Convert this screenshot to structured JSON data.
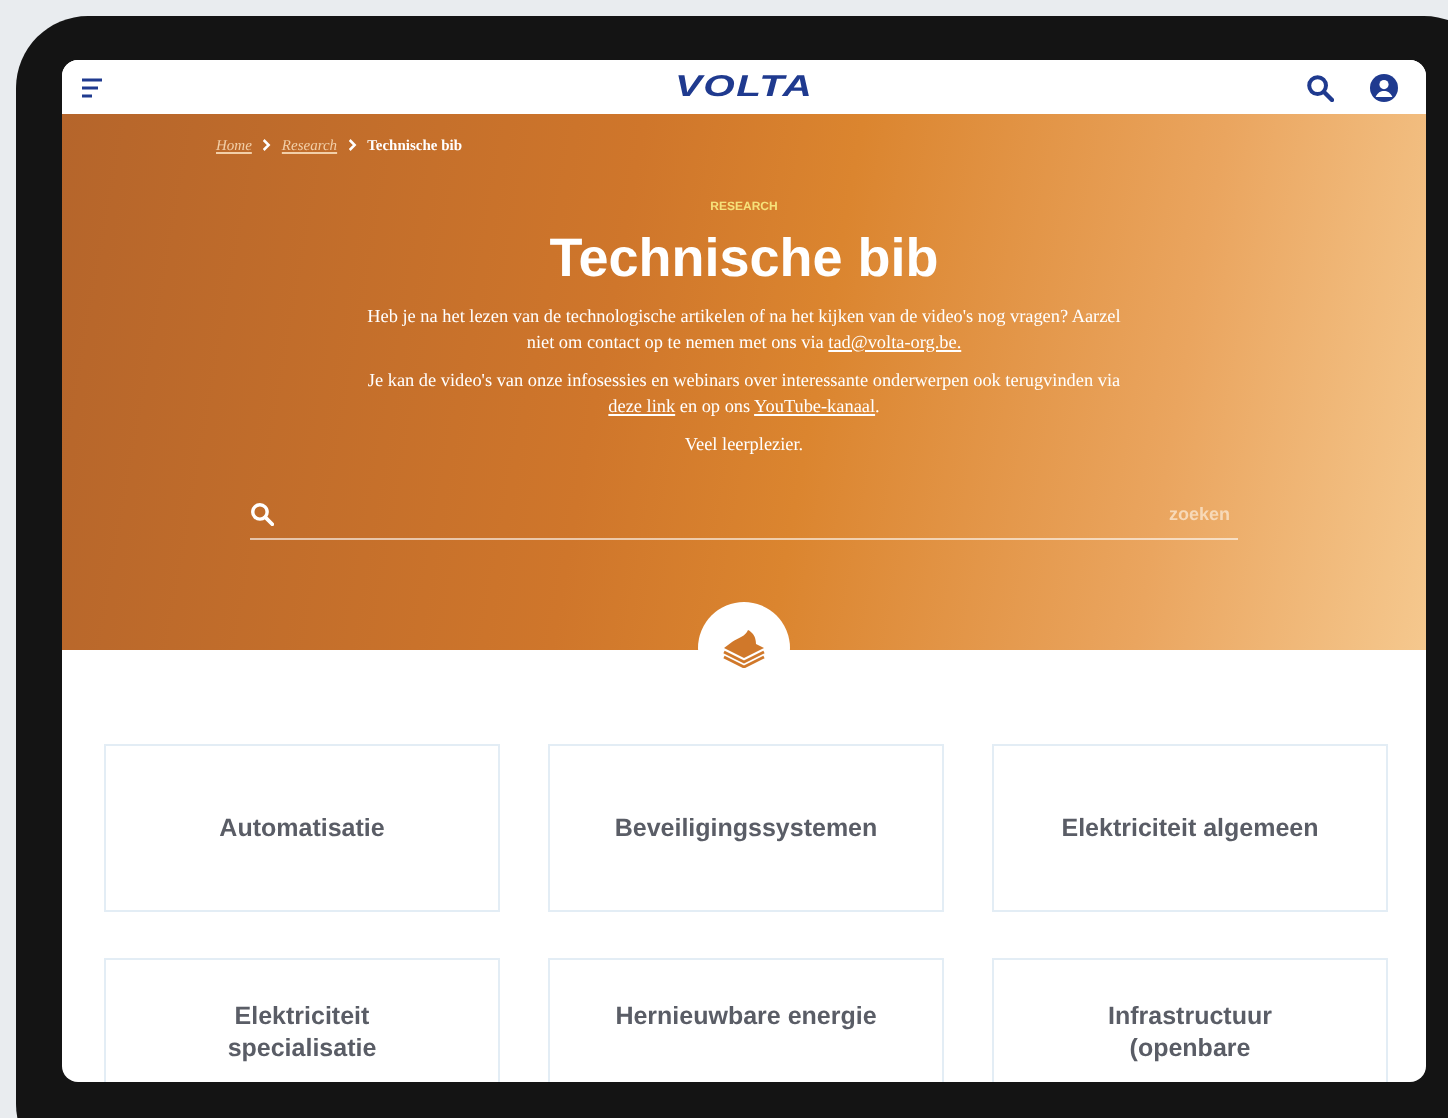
{
  "header": {
    "logo": "VOLTA"
  },
  "breadcrumbs": [
    {
      "label": "Home",
      "kind": "link"
    },
    {
      "label": "Research",
      "kind": "link"
    },
    {
      "label": "Technische bib",
      "kind": "current"
    }
  ],
  "hero": {
    "eyebrow": "RESEARCH",
    "title": "Technische bib",
    "paragraphs": [
      [
        {
          "kind": "text",
          "text": "Heb je na het lezen van de technologische artikelen of na het kijken van de video's nog vragen? Aarzel niet om contact op te nemen met ons via "
        },
        {
          "kind": "link",
          "text": "tad@volta-org.be."
        }
      ],
      [
        {
          "kind": "text",
          "text": "Je kan de video's van onze infosessies en webinars over interessante onderwerpen ook terugvinden via "
        },
        {
          "kind": "link",
          "text": "deze link"
        },
        {
          "kind": "text",
          "text": " en op ons "
        },
        {
          "kind": "link",
          "text": "YouTube-kanaal"
        },
        {
          "kind": "text",
          "text": "."
        }
      ],
      [
        {
          "kind": "text",
          "text": "Veel leerplezier."
        }
      ]
    ],
    "search": {
      "button": "zoeken"
    }
  },
  "categories": [
    "Automatisatie",
    "Beveiligingssystemen",
    "Elektriciteit algemeen",
    "Elektriciteit specialisatie",
    "Hernieuwbare energie",
    "Infrastructuur (openbare"
  ]
}
